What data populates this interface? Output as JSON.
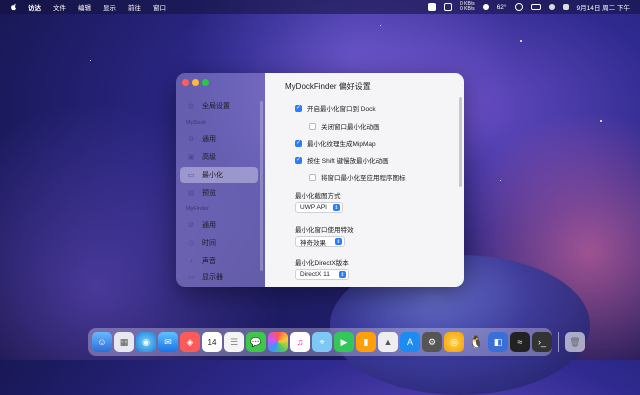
{
  "menubar": {
    "app_name": "访达",
    "items": [
      "文件",
      "编辑",
      "显示",
      "前往",
      "窗口"
    ],
    "net_up": "0 KB/s",
    "net_down": "0 KB/s",
    "temperature": "62°",
    "datetime": "9月14日 周二 下午"
  },
  "window": {
    "title": "MyDockFinder 偏好设置",
    "sidebar": {
      "top_item": "全局设置",
      "section_mydock": "MyDock",
      "mydock_items": [
        {
          "label": "通用",
          "icon": "gear-icon"
        },
        {
          "label": "高级",
          "icon": "advanced-icon"
        },
        {
          "label": "最小化",
          "icon": "minimize-icon",
          "selected": true
        },
        {
          "label": "预览",
          "icon": "preview-icon"
        }
      ],
      "section_myfinder": "MyFinder",
      "myfinder_items": [
        {
          "label": "通用",
          "icon": "gear-icon"
        },
        {
          "label": "时间",
          "icon": "clock-icon"
        },
        {
          "label": "声音",
          "icon": "sound-icon"
        },
        {
          "label": "显示器",
          "icon": "display-icon"
        }
      ]
    },
    "options": [
      {
        "label": "开启最小化窗口到 Dock",
        "checked": true
      },
      {
        "label": "关闭窗口最小化动画",
        "checked": false
      },
      {
        "label": "最小化纹理生成MipMap",
        "checked": true
      },
      {
        "label": "按住 Shift 键慢放最小化动画",
        "checked": true
      },
      {
        "label": "将窗口最小化至应用程序图标",
        "checked": false
      }
    ],
    "screenshot_label": "最小化截图方式",
    "screenshot_value": "UWP API",
    "effect_label": "最小化窗口使用特效",
    "effect_value": "神奇效果",
    "directx_label": "最小化DirectX版本",
    "directx_value": "DirectX 11"
  },
  "dock": {
    "calendar_day": "14"
  },
  "colors": {
    "accent": "#2b7cf6",
    "close": "#ff5f57",
    "minimize": "#febc2e",
    "zoom": "#28c840"
  }
}
